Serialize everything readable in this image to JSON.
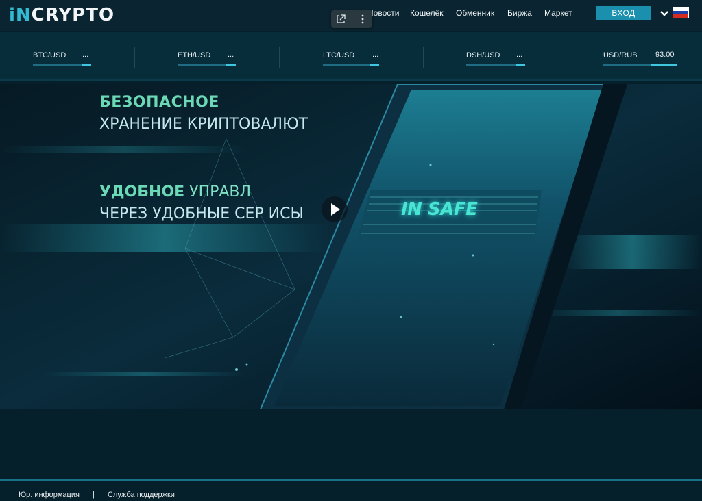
{
  "header": {
    "logo_accent": "iN",
    "logo_rest": "CRYPTO",
    "nav": [
      {
        "label": "Новости"
      },
      {
        "label": "Кошелёк"
      },
      {
        "label": "Обменник"
      },
      {
        "label": "Биржа"
      },
      {
        "label": "Маркет"
      }
    ],
    "login_label": "ВХОД",
    "language": "ru",
    "language_icon": "chevron-down-icon",
    "flag_colors": [
      "#ffffff",
      "#1c3fa8",
      "#d52b1e"
    ]
  },
  "overlay_toolbar": {
    "open_icon": "open-external-icon",
    "menu_icon": "more-vertical-icon"
  },
  "ticker": {
    "items": [
      {
        "pair": "BTC/USD",
        "value": "..."
      },
      {
        "pair": "ETH/USD",
        "value": "..."
      },
      {
        "pair": "LTC/USD",
        "value": "..."
      },
      {
        "pair": "DSH/USD",
        "value": "..."
      },
      {
        "pair": "USD/RUB",
        "value": "93.00"
      }
    ]
  },
  "hero": {
    "line1": "БЕЗОПАСНОЕ",
    "line2": "ХРАНЕНИЕ КРИПТОВАЛЮТ",
    "line3_bold": "УДОБНОЕ",
    "line3_rest": " УПРАВЛ",
    "line4": "ЧЕРЕЗ УДОБНЫЕ СЕР   ИСЫ",
    "device_label": "IN SAFE",
    "play_icon": "play-icon"
  },
  "footer": {
    "legal_label": "Юр. информация",
    "separator": "|",
    "support_label": "Служба поддержки"
  },
  "colors": {
    "accent": "#33b9d2",
    "login_button": "#1b8fae",
    "background": "#06202b"
  }
}
